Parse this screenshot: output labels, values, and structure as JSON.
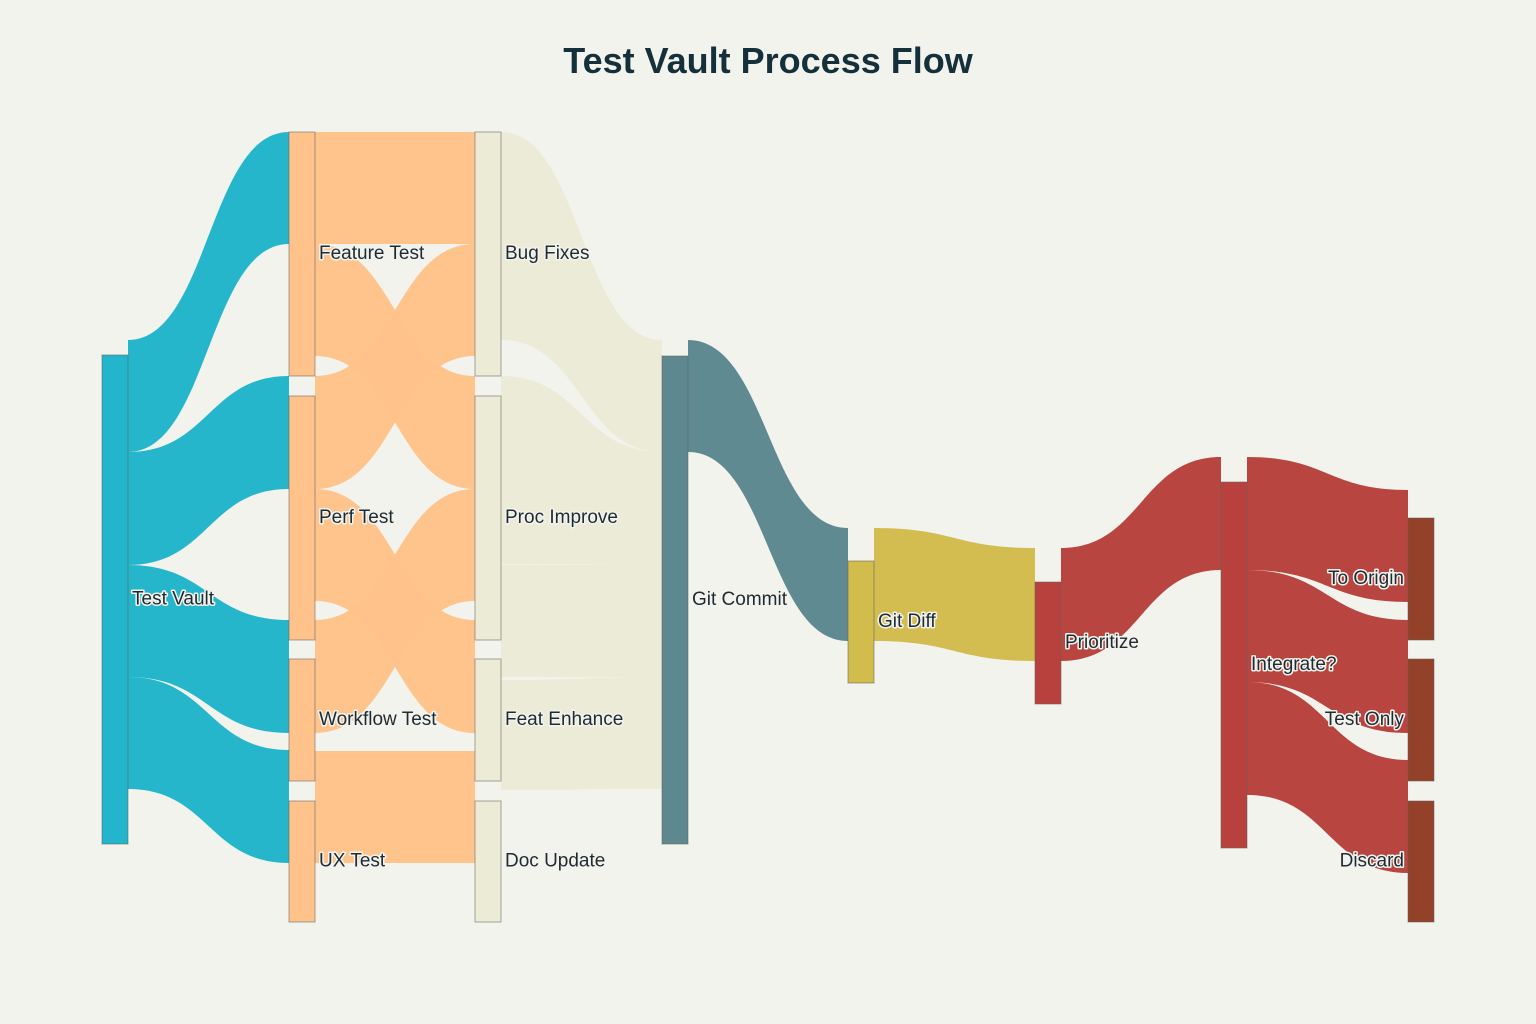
{
  "chart_data": {
    "type": "sankey",
    "title": "Test Vault Process Flow",
    "nodes": [
      {
        "id": "test_vault",
        "label": "Test Vault",
        "color": "#22b5cb"
      },
      {
        "id": "feature_test",
        "label": "Feature Test",
        "color": "#ffc28a"
      },
      {
        "id": "perf_test",
        "label": "Perf Test",
        "color": "#ffc28a"
      },
      {
        "id": "workflow_test",
        "label": "Workflow Test",
        "color": "#ffc28a"
      },
      {
        "id": "ux_test",
        "label": "UX Test",
        "color": "#ffc28a"
      },
      {
        "id": "bug_fixes",
        "label": "Bug Fixes",
        "color": "#ecebd6"
      },
      {
        "id": "proc_improve",
        "label": "Proc Improve",
        "color": "#ecebd6"
      },
      {
        "id": "feat_enhance",
        "label": "Feat Enhance",
        "color": "#ecebd6"
      },
      {
        "id": "doc_update",
        "label": "Doc Update",
        "color": "#ecebd6"
      },
      {
        "id": "git_commit",
        "label": "Git Commit",
        "color": "#5d8890"
      },
      {
        "id": "git_diff",
        "label": "Git Diff",
        "color": "#d2bc4c"
      },
      {
        "id": "prioritize",
        "label": "Prioritize",
        "color": "#b8413d"
      },
      {
        "id": "integrate",
        "label": "Integrate?",
        "color": "#b8413d"
      },
      {
        "id": "to_origin",
        "label": "To Origin",
        "color": "#94412a"
      },
      {
        "id": "test_only",
        "label": "Test Only",
        "color": "#94412a"
      },
      {
        "id": "discard",
        "label": "Discard",
        "color": "#94412a"
      }
    ],
    "links": [
      {
        "source": "test_vault",
        "target": "feature_test",
        "value": 1
      },
      {
        "source": "test_vault",
        "target": "perf_test",
        "value": 1
      },
      {
        "source": "test_vault",
        "target": "workflow_test",
        "value": 1
      },
      {
        "source": "test_vault",
        "target": "ux_test",
        "value": 1
      },
      {
        "source": "feature_test",
        "target": "bug_fixes",
        "value": 1
      },
      {
        "source": "feature_test",
        "target": "proc_improve",
        "value": 1
      },
      {
        "source": "perf_test",
        "target": "bug_fixes",
        "value": 1
      },
      {
        "source": "perf_test",
        "target": "feat_enhance",
        "value": 1
      },
      {
        "source": "workflow_test",
        "target": "proc_improve",
        "value": 1
      },
      {
        "source": "ux_test",
        "target": "doc_update",
        "value": 1
      },
      {
        "source": "bug_fixes",
        "target": "git_commit",
        "value": 1
      },
      {
        "source": "proc_improve",
        "target": "git_commit",
        "value": 1
      },
      {
        "source": "feat_enhance",
        "target": "git_commit",
        "value": 1
      },
      {
        "source": "doc_update",
        "target": "git_commit",
        "value": 1
      },
      {
        "source": "git_commit",
        "target": "git_diff",
        "value": 1
      },
      {
        "source": "git_diff",
        "target": "prioritize",
        "value": 1
      },
      {
        "source": "prioritize",
        "target": "integrate",
        "value": 1
      },
      {
        "source": "integrate",
        "target": "to_origin",
        "value": 1
      },
      {
        "source": "integrate",
        "target": "test_only",
        "value": 1
      },
      {
        "source": "integrate",
        "target": "discard",
        "value": 1
      }
    ]
  }
}
